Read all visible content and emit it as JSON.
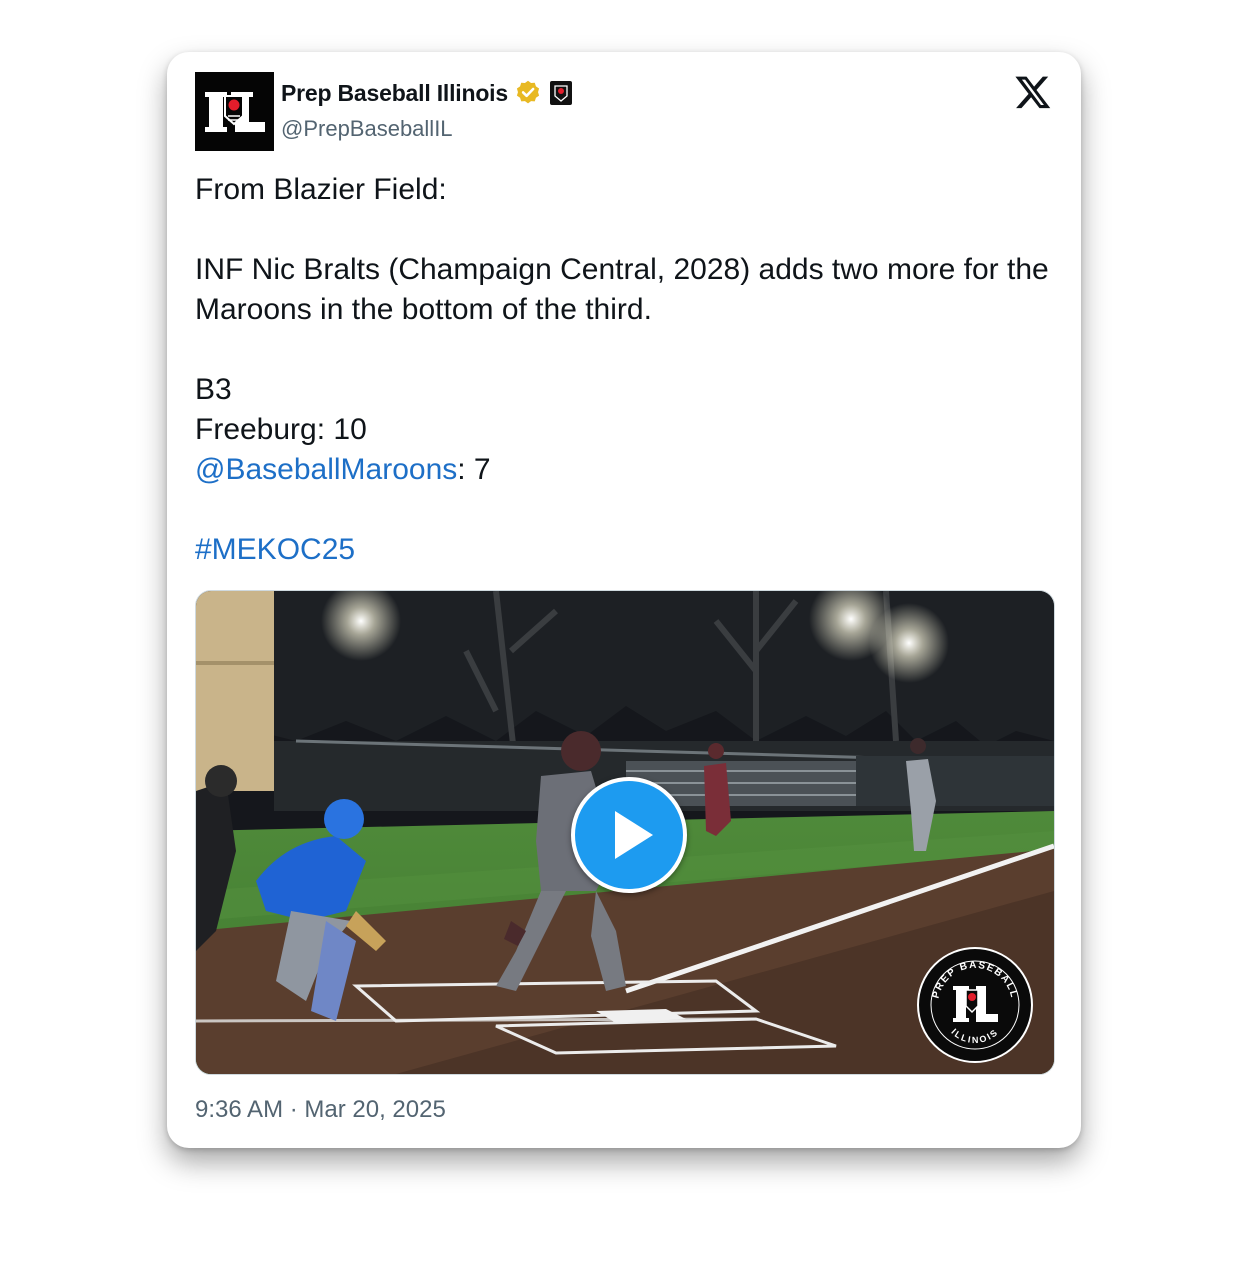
{
  "tweet": {
    "display_name": "Prep Baseball Illinois",
    "handle": "@PrepBaseballIL",
    "verified_icon": "gold-verified-badge-icon",
    "avatar_letters": "IL",
    "platform_icon": "x-logo-icon",
    "lines": {
      "intro": "From Blazier Field:",
      "body": "INF Nic Bralts (Champaign Central, 2028) adds two more for the Maroons in the bottom of the third.",
      "inning": "B3",
      "score_line_1": "Freeburg: 10",
      "mention": "@BaseballMaroons",
      "score_line_2_suffix": ": 7",
      "hashtag": "#MEKOC25"
    },
    "media": {
      "type": "video",
      "play_icon": "play-icon",
      "watermark_top": "PREP BASEBALL",
      "watermark_bottom": "ILLINOIS",
      "watermark_letters": "IL"
    },
    "timestamp": "9:36 AM · Mar 20, 2025"
  },
  "colors": {
    "text": "#0f1419",
    "secondary": "#536471",
    "link": "#1d6fc7",
    "play_button": "#1d9bf0",
    "verified_gold": "#e8b923"
  }
}
